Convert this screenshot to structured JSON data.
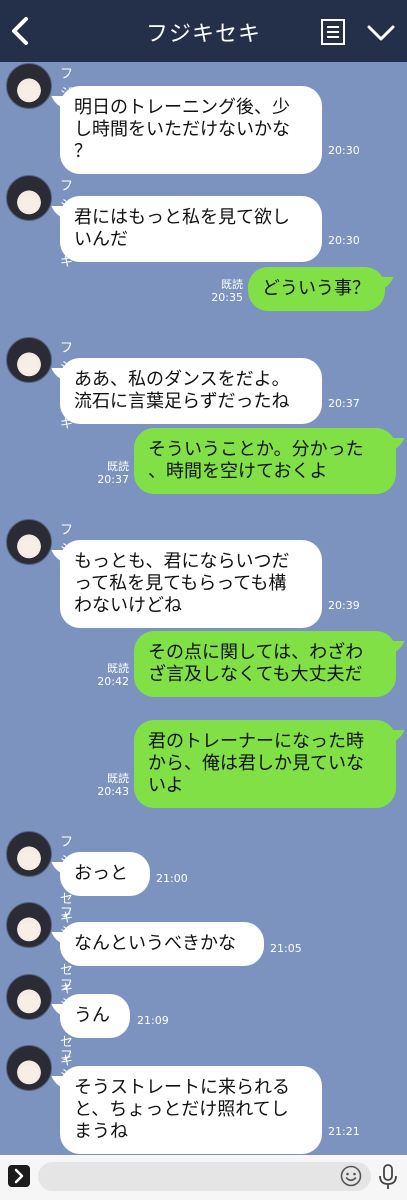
{
  "header": {
    "title": "フジキセキ"
  },
  "contact_name": "フジキセキ",
  "read_label": "既読",
  "messages": [
    {
      "dir": "in",
      "text": "明日のトレーニング後、少\nし時間をいただけないかな\n？",
      "time": "20:30"
    },
    {
      "dir": "in",
      "text": "君にはもっと私を見て欲し\nいんだ",
      "time": "20:30"
    },
    {
      "dir": "out",
      "text": "どういう事？",
      "time": "20:35"
    },
    {
      "dir": "in",
      "text": "ああ、私のダンスをだよ。\n流石に言葉足らずだったね",
      "time": "20:37"
    },
    {
      "dir": "out",
      "text": "そういうことか。分かった\n、時間を空けておくよ",
      "time": "20:37"
    },
    {
      "dir": "in",
      "text": "もっとも、君にならいつだ\nって私を見てもらっても構\nわないけどね",
      "time": "20:39"
    },
    {
      "dir": "out",
      "text": "その点に関しては、わざわ\nざ言及しなくても大丈夫だ",
      "time": "20:42"
    },
    {
      "dir": "out",
      "text": "君のトレーナーになった時\nから、俺は君しか見ていな\nいよ",
      "time": "20:43"
    },
    {
      "dir": "in",
      "text": "おっと",
      "time": "21:00"
    },
    {
      "dir": "in",
      "text": "なんというべきかな",
      "time": "21:05"
    },
    {
      "dir": "in",
      "text": "うん",
      "time": "21:09"
    },
    {
      "dir": "in",
      "text": "そうストレートに来られる\nと、ちょっとだけ照れてし\nまうね",
      "time": "21:21"
    }
  ],
  "footer": {
    "input_placeholder": ""
  },
  "colors": {
    "background": "#7b93be",
    "header": "#243049",
    "incoming_bubble": "#ffffff",
    "outgoing_bubble": "#80e046"
  },
  "icons": [
    "back-arrow-icon",
    "memo-icon",
    "chevron-down-icon",
    "keyboard-toggle-icon",
    "emoji-icon",
    "microphone-icon"
  ]
}
